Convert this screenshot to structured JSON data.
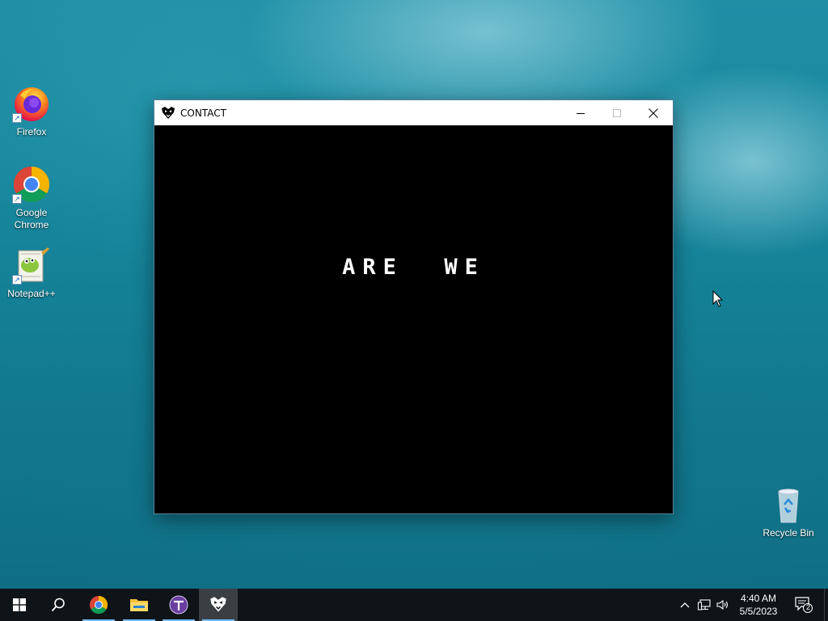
{
  "desktop": {
    "icons": [
      {
        "label": "Firefox",
        "icon": "firefox-icon"
      },
      {
        "label": "Google Chrome",
        "icon": "chrome-icon"
      },
      {
        "label": "Notepad++",
        "icon": "notepadpp-icon"
      },
      {
        "label": "Recycle Bin",
        "icon": "recycle-bin-icon"
      }
    ]
  },
  "window": {
    "title": "CONTACT",
    "app_icon": "heart-emblem-icon",
    "buttons": {
      "minimize": "minimize-icon",
      "maximize": "maximize-icon",
      "close": "close-icon"
    },
    "game_text": "ARE  WE"
  },
  "taskbar": {
    "apps": [
      {
        "name": "start",
        "icon": "windows-logo-icon"
      },
      {
        "name": "search",
        "icon": "search-icon"
      },
      {
        "name": "chrome",
        "icon": "chrome-icon"
      },
      {
        "name": "file-explorer",
        "icon": "folder-icon"
      },
      {
        "name": "tor-app",
        "icon": "purple-orb-icon"
      },
      {
        "name": "contact",
        "icon": "heart-emblem-icon"
      }
    ],
    "tray": {
      "clock_time": "4:40 AM",
      "clock_date": "5/5/2023",
      "notification_count": "2"
    }
  },
  "colors": {
    "accent": "#76b9ed",
    "taskbar_bg": "#0e1418",
    "window_bg": "#000000",
    "titlebar_bg": "#ffffff"
  }
}
